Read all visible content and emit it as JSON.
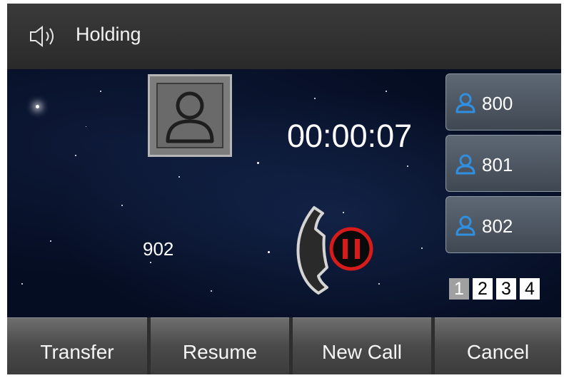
{
  "header": {
    "title": "Holding",
    "icon": "speaker-icon"
  },
  "call": {
    "duration": "00:00:07",
    "number": "902",
    "status_icon": "call-hold-icon"
  },
  "lines": [
    {
      "label": "800",
      "icon": "contact-icon"
    },
    {
      "label": "801",
      "icon": "contact-icon"
    },
    {
      "label": "802",
      "icon": "contact-icon"
    }
  ],
  "pages": {
    "items": [
      "1",
      "2",
      "3",
      "4"
    ],
    "active": "1"
  },
  "softkeys": {
    "transfer": "Transfer",
    "resume": "Resume",
    "new_call": "New Call",
    "cancel": "Cancel"
  },
  "colors": {
    "accent_blue": "#2f8fe0",
    "hold_red": "#d71a1a",
    "background": "#07122a"
  }
}
